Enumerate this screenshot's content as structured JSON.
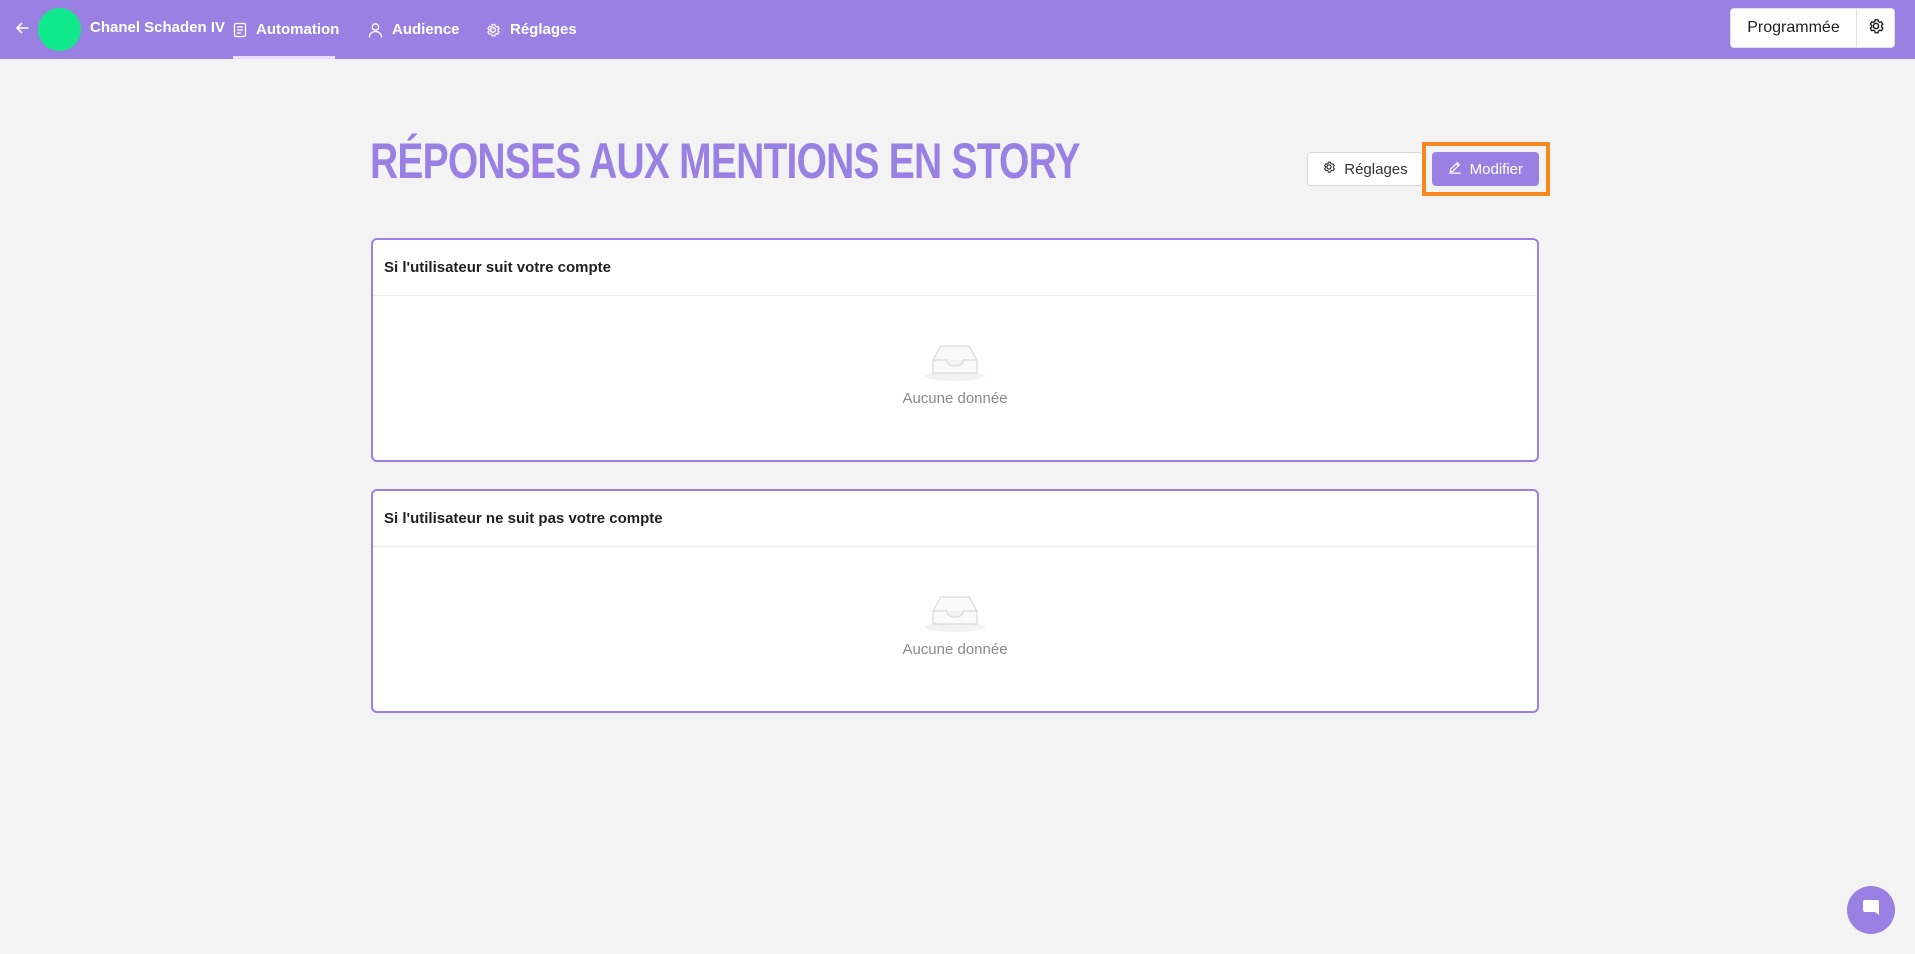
{
  "topbar": {
    "account_name": "Chanel Schaden IV",
    "tabs": [
      {
        "label": "Automation",
        "icon": "document-icon",
        "active": true
      },
      {
        "label": "Audience",
        "icon": "user-icon",
        "active": false
      },
      {
        "label": "Réglages",
        "icon": "gear-icon",
        "active": false
      }
    ],
    "status_label": "Programmée"
  },
  "page": {
    "title": "RÉPONSES AUX MENTIONS EN STORY",
    "settings_button": "Réglages",
    "edit_button": "Modifier"
  },
  "cards": [
    {
      "title": "Si l'utilisateur suit votre compte",
      "empty_text": "Aucune donnée"
    },
    {
      "title": "Si l'utilisateur ne suit pas votre compte",
      "empty_text": "Aucune donnée"
    }
  ],
  "colors": {
    "brand": "#9a80e3",
    "avatar": "#10e98b",
    "highlight": "#f6881f",
    "background": "#f3f3f3"
  }
}
